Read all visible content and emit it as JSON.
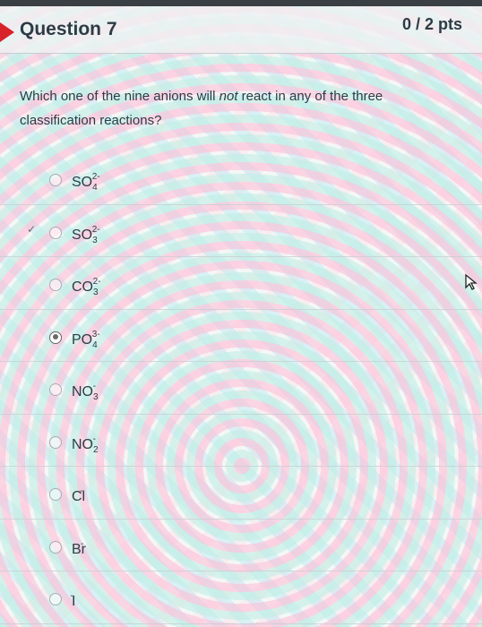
{
  "question": {
    "title": "Question 7",
    "points": "0 / 2 pts",
    "text_before": "Which one of the nine anions will ",
    "text_em": "not",
    "text_after": " react in any of the three classification reactions?"
  },
  "answers": [
    {
      "base": "SO",
      "sub": "4",
      "sup": "2-",
      "selected": false
    },
    {
      "base": "SO",
      "sub": "3",
      "sup": "2-",
      "selected": false,
      "check_mark": "✓"
    },
    {
      "base": "CO",
      "sub": "3",
      "sup": "2-",
      "selected": false
    },
    {
      "base": "PO",
      "sub": "4",
      "sup": "3-",
      "selected": true
    },
    {
      "base": "NO",
      "sub": "3",
      "sup": "-",
      "selected": false
    },
    {
      "base": "NO",
      "sub": "2",
      "sup": "-",
      "selected": false
    },
    {
      "base": "Cl",
      "sub": "",
      "sup": "-",
      "selected": false
    },
    {
      "base": "Br",
      "sub": "",
      "sup": "-",
      "selected": false
    },
    {
      "base": "I",
      "sub": "",
      "sup": "-",
      "selected": false
    }
  ],
  "colors": {
    "flag": "#d8232a",
    "text": "#2d3b45",
    "topbar": "#3a3f44"
  },
  "icons": {
    "cursor": "mouse-pointer-icon",
    "flag": "flag-icon"
  }
}
